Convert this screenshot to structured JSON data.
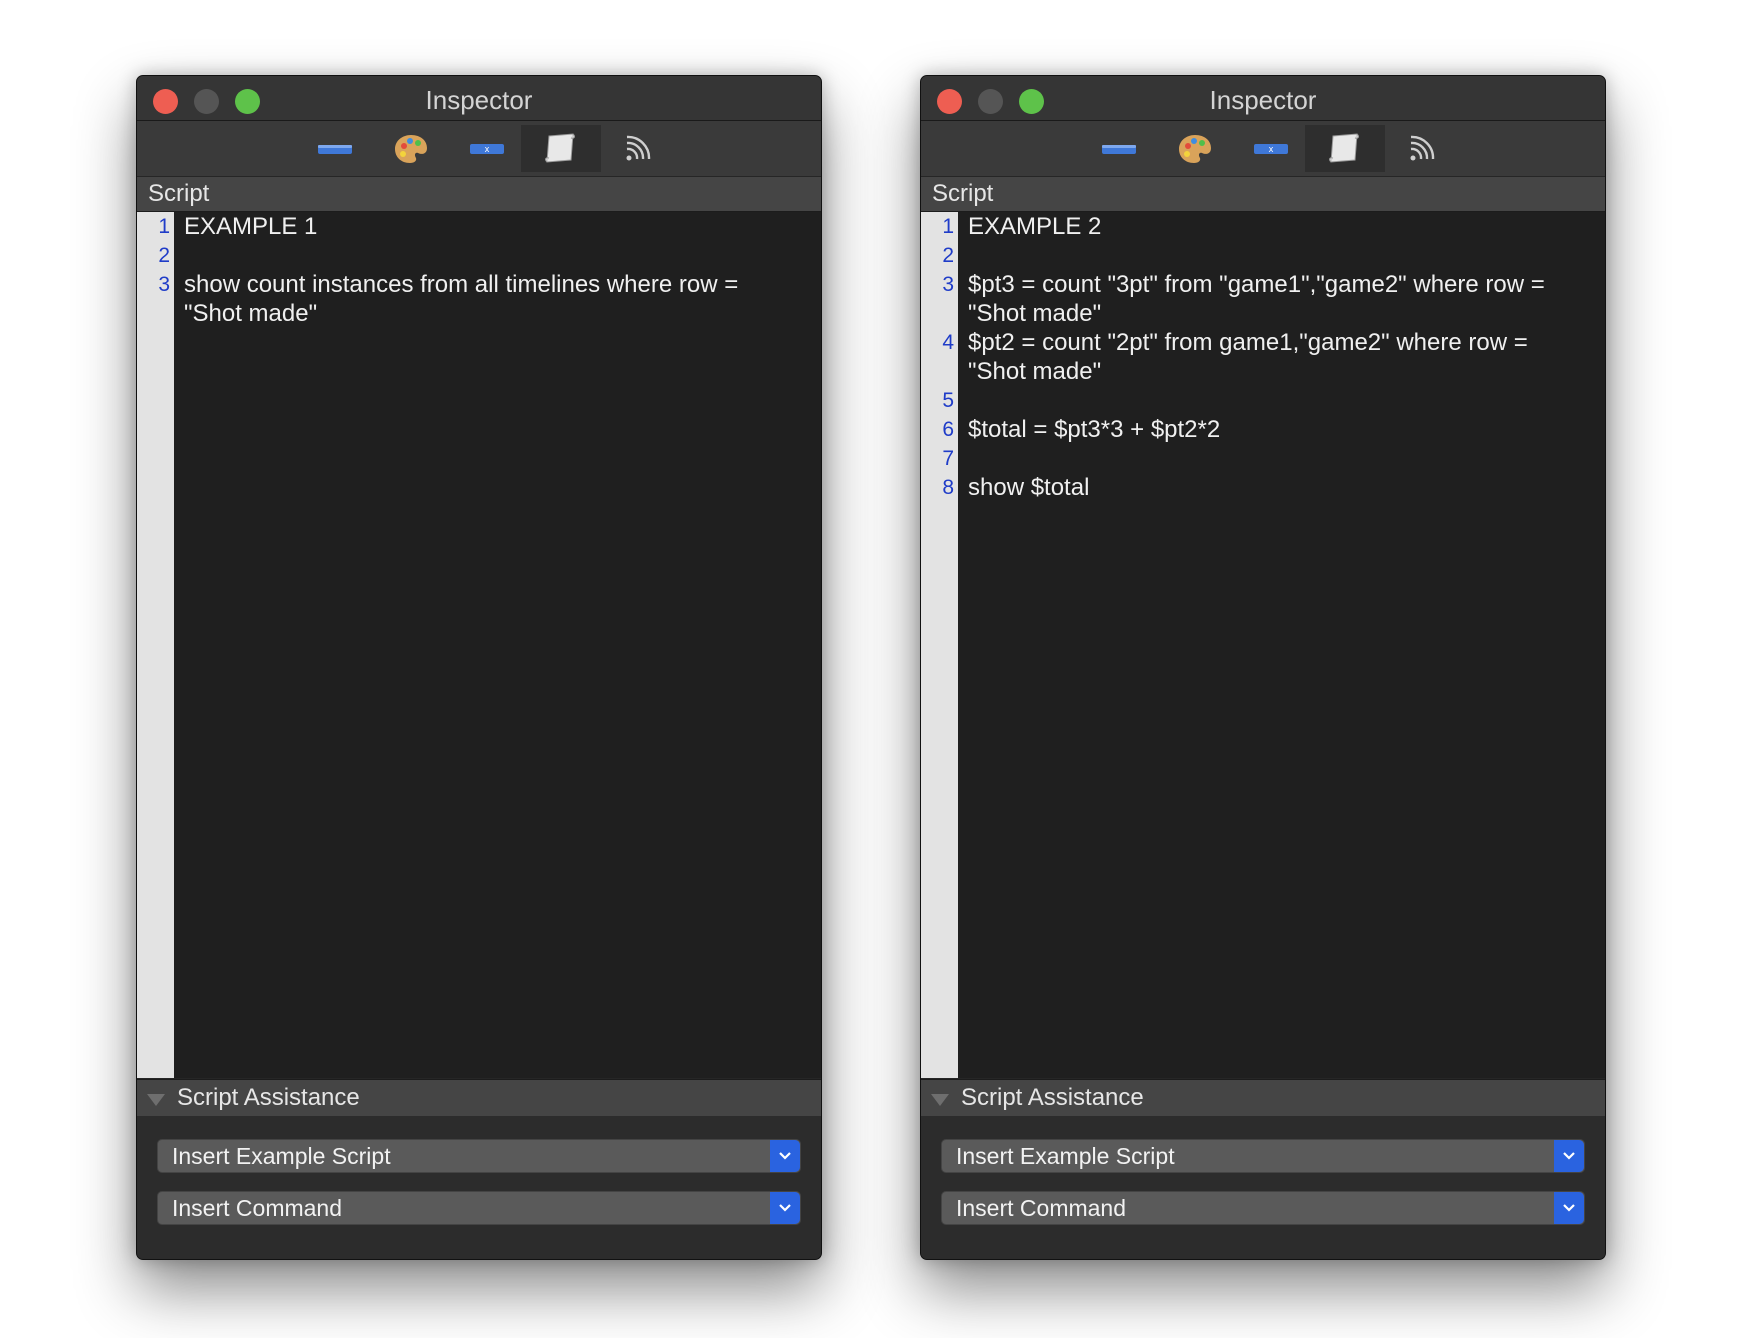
{
  "windows": [
    {
      "title": "Inspector",
      "section_label": "Script",
      "lines": [
        {
          "n": "1",
          "text": "EXAMPLE 1"
        },
        {
          "n": "2",
          "text": ""
        },
        {
          "n": "3",
          "text": "show count instances from all timelines where row =\n\"Shot made\""
        }
      ],
      "assist_label": "Script Assistance",
      "example_popup": "Insert Example Script",
      "command_popup": "Insert Command"
    },
    {
      "title": "Inspector",
      "section_label": "Script",
      "lines": [
        {
          "n": "1",
          "text": "EXAMPLE 2"
        },
        {
          "n": "2",
          "text": ""
        },
        {
          "n": "3",
          "text": "$pt3 = count \"3pt\" from \"game1\",\"game2\" where row =\n\"Shot made\""
        },
        {
          "n": "4",
          "text": "$pt2 = count \"2pt\" from game1,\"game2\" where row =\n\"Shot made\""
        },
        {
          "n": "5",
          "text": ""
        },
        {
          "n": "6",
          "text": "$total = $pt3*3 + $pt2*2"
        },
        {
          "n": "7",
          "text": ""
        },
        {
          "n": "8",
          "text": "show $total"
        }
      ],
      "assist_label": "Script Assistance",
      "example_popup": "Insert Example Script",
      "command_popup": "Insert Command"
    }
  ],
  "toolbar_icons": [
    "label-icon",
    "palette-icon",
    "variable-icon",
    "script-icon",
    "rss-feed-icon"
  ],
  "colors": {
    "line_number": "#1f3cc8",
    "editor_bg": "#1f1f1f",
    "popup_accent": "#2a63e0",
    "close_light": "#ee5e52",
    "zoom_light": "#5ec24a"
  }
}
